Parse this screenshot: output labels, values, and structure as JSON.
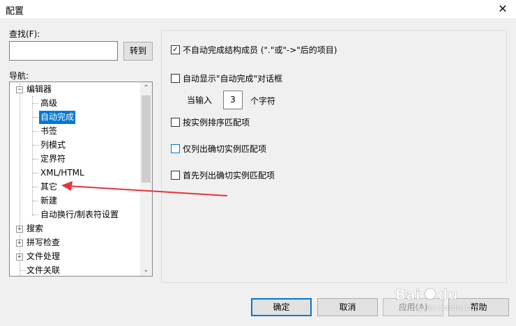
{
  "window": {
    "title": "配置",
    "close_glyph": "✕"
  },
  "find": {
    "label": "查找(F):",
    "value": "",
    "goto_label": "转到"
  },
  "nav": {
    "label": "导航:",
    "items": [
      {
        "label": "编辑器",
        "expander": "−"
      },
      {
        "label": "高级"
      },
      {
        "label": "自动完成"
      },
      {
        "label": "书签"
      },
      {
        "label": "列模式"
      },
      {
        "label": "定界符"
      },
      {
        "label": "XML/HTML"
      },
      {
        "label": "其它"
      },
      {
        "label": "新建"
      },
      {
        "label": "自动换行/制表符设置"
      },
      {
        "label": "搜索",
        "expander": "+"
      },
      {
        "label": "拼写检查",
        "expander": "+"
      },
      {
        "label": "文件处理",
        "expander": "+"
      },
      {
        "label": "文件关联"
      }
    ],
    "scroll_up": "⌃",
    "scroll_down": "⌄"
  },
  "options": {
    "opt1": {
      "label": "不自动完成结构成员 (\".\"或\"->\"后的项目)",
      "checked": true,
      "mark": "✓"
    },
    "opt2": {
      "label": "自动显示\"自动完成\"对话框",
      "checked": false
    },
    "when_label": "当输入",
    "count_value": "3",
    "count_unit": "个字符",
    "opt3": {
      "label": "按实例排序匹配项",
      "checked": false
    },
    "opt4": {
      "label": "仅列出确切实例匹配项",
      "checked": false
    },
    "opt5": {
      "label": "首先列出确切实例匹配项",
      "checked": false
    }
  },
  "buttons": {
    "ok": "确定",
    "cancel": "取消",
    "apply": "应用(A)",
    "help": "帮助"
  },
  "watermark": {
    "text": "jingyan.baidu.com"
  },
  "colors": {
    "selection": "#0078d7",
    "arrow": "#e8323c"
  }
}
